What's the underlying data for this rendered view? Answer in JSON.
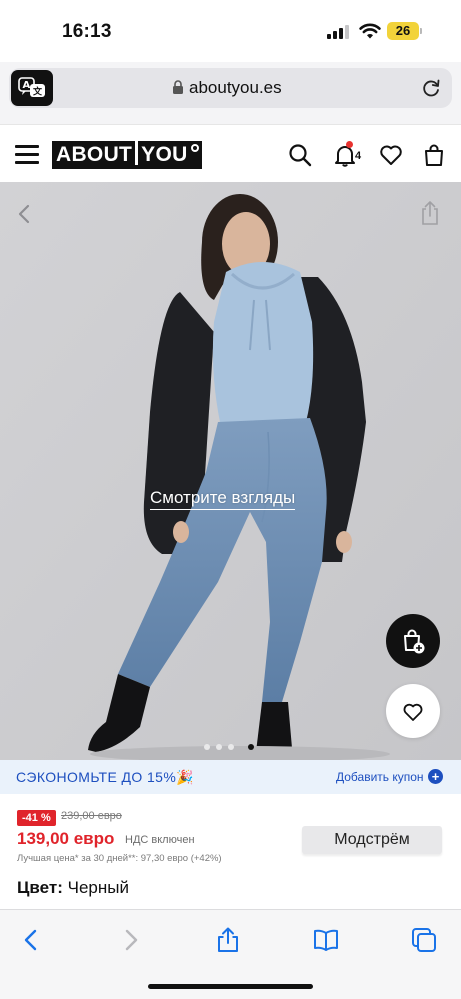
{
  "status_bar": {
    "time": "16:13",
    "battery": "26",
    "signal_bars_filled": 3,
    "battery_color": "#f2d33a"
  },
  "browser": {
    "url": "aboutyou.es",
    "translate_icon": "translate-icon",
    "reload_icon": "reload-icon"
  },
  "header": {
    "logo_left": "ABOUT",
    "logo_right": "YOU",
    "notification_count": "4",
    "icons": [
      "menu-icon",
      "search-icon",
      "bell-icon",
      "heart-icon",
      "bag-icon"
    ]
  },
  "product_image": {
    "looks_link": "Смотрите взгляды",
    "carousel_total": 4,
    "carousel_active": 4
  },
  "coupon": {
    "text": "СЭКОНОМЬТЕ ДО 15%🎉",
    "link": "Добавить купон",
    "plus": "+",
    "color": "#1d4fbf"
  },
  "price": {
    "discount": "-41 %",
    "old": "239,00 евро",
    "current": "139,00 евро",
    "vat": "НДС включен",
    "best_price": "Лучшая цена* за 30 дней**: 97,30 евро (+42%)",
    "accent": "#e0242b"
  },
  "size_button": "Модстрём",
  "color": {
    "label": "Цвет:",
    "value": "Черный"
  },
  "toolbar": {
    "icons": [
      "back-icon",
      "forward-icon",
      "share-icon",
      "bookmarks-icon",
      "tabs-icon"
    ]
  }
}
